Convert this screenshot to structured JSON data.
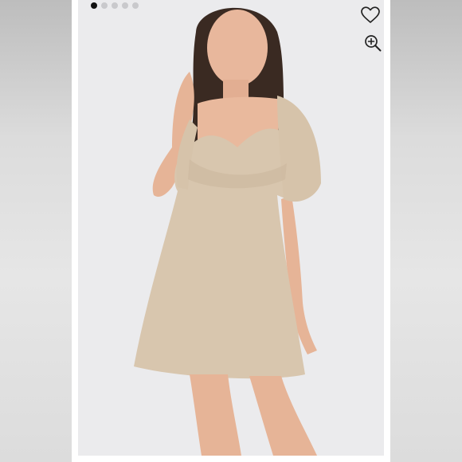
{
  "carousel": {
    "total_slides": 5,
    "active_index": 0
  },
  "icons": {
    "like": "heart-outline-icon",
    "zoom": "zoom-in-icon"
  },
  "colors": {
    "background": "#ebebed",
    "dress": "#d8c6ae",
    "skin": "#e8b79c",
    "hair": "#3a2a22",
    "dot_active": "#111111",
    "dot_inactive": "#c9c9cc"
  }
}
